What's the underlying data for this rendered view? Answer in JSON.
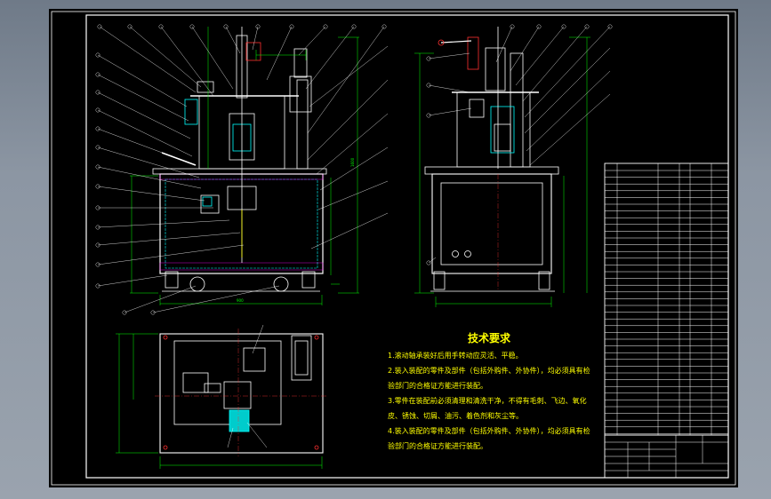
{
  "drawing": {
    "background": "#000000",
    "frame_color": "#ffffff",
    "part_color": "#ffffff",
    "dim_color": "#00ff00",
    "leader_color": "#ffffff",
    "center_color": "#ff3030",
    "accent_cyan": "#00ffff",
    "accent_magenta": "#ff00ff",
    "accent_yellow": "#ffff00"
  },
  "tech_requirements": {
    "title": "技术要求",
    "lines": [
      "1.滚动轴承装好后用手转动应灵活、平稳。",
      "2.装入装配的零件及部件（包括外购件、外协件），均必须具有检",
      "   验部门的合格证方能进行装配。",
      "3.零件在装配前必须清理和清洗干净，不得有毛刺、飞边、氧化",
      "   皮、锈蚀、切屑、油污、着色剂和灰尘等。",
      "4.装入装配的零件及部件（包括外购件、外协件），均必须具有检",
      "   验部门的合格证方能进行装配。"
    ]
  }
}
